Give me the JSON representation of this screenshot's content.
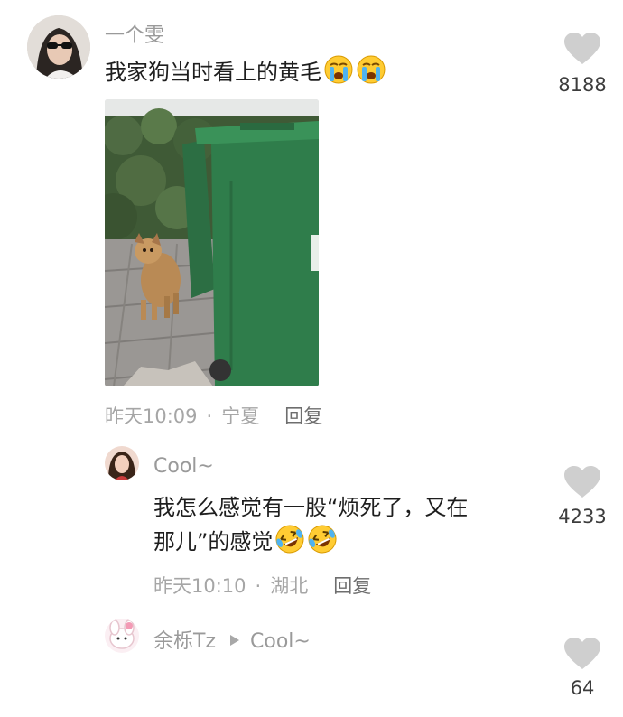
{
  "comments": [
    {
      "username": "一个雯",
      "text": "我家狗当时看上的黄毛",
      "emojis": [
        "loudly-crying-face",
        "loudly-crying-face"
      ],
      "time": "昨天10:09",
      "location": "宁夏",
      "reply_label": "回复",
      "likes": "8188"
    }
  ],
  "replies": [
    {
      "username": "Cool~",
      "text_line1": "我怎么感觉有一股“烦死了，又在",
      "text_line2": "那儿”的感觉",
      "emojis": [
        "rolling-laughing-face",
        "rolling-laughing-face"
      ],
      "time": "昨天10:10",
      "location": "湖北",
      "reply_label": "回复",
      "likes": "4233"
    },
    {
      "username": "余栎Tz",
      "reply_to": "Cool~",
      "likes": "64"
    }
  ],
  "separator": "·",
  "icons": {
    "like": "heart-icon",
    "reply_arrow": "triangle-right-icon"
  },
  "colors": {
    "text": "#1e1e1e",
    "username": "#9a9a9a",
    "meta": "#a6a6a6",
    "heart": "#cfcfcf",
    "bin_green": "#2f7d4b"
  }
}
